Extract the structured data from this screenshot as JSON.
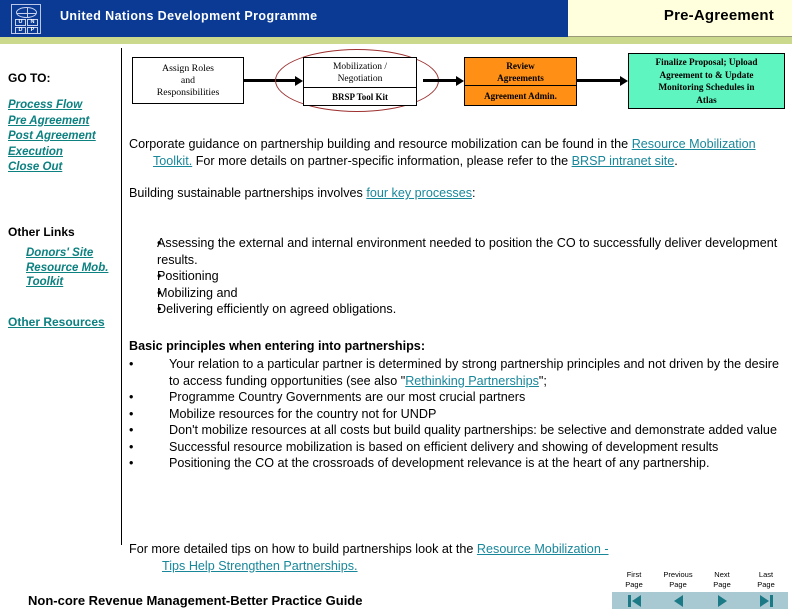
{
  "header": {
    "org_title": "United Nations Development Programme",
    "section_title": "Pre-Agreement",
    "logo_letters": [
      "U",
      "N",
      "D",
      "P"
    ],
    "blue": "#0a3a93",
    "stripe": "#cbd98c",
    "cream": "#ffffdd"
  },
  "sidebar": {
    "goto_label": "GO TO:",
    "goto_links": [
      {
        "label": "Process Flow"
      },
      {
        "label": "Pre Agreement"
      },
      {
        "label": "Post Agreement"
      },
      {
        "label": "Execution"
      },
      {
        "label": "Close Out"
      }
    ],
    "other_links_label": "Other Links",
    "other_links": [
      {
        "label": "Donors' Site"
      },
      {
        "label": "Resource Mob."
      },
      {
        "label": "  Toolkit"
      }
    ],
    "other_resources_label": "Other Resources",
    "link_color": "#0d8080"
  },
  "flow": {
    "assign": "Assign Roles and Responsibilities",
    "assign_lines": [
      "Assign Roles",
      "and",
      "Responsibilities"
    ],
    "mobilization": "Mobilization / Negotiation",
    "mobilization_lines": [
      "Mobilization /",
      "Negotiation"
    ],
    "toolkit": "BRSP Tool Kit",
    "review": "Review Agreements",
    "review_lines": [
      "Review",
      "Agreements"
    ],
    "agreement_admin": "Agreement Admin.",
    "finalize": "Finalize Proposal; Upload Agreement to & Update Monitoring Schedules in Atlas",
    "finalize_lines": [
      "Finalize Proposal; Upload",
      "Agreement to & Update",
      "Monitoring Schedules in",
      "Atlas"
    ],
    "oval_color": "#9d3030",
    "review_color": "#ff9015",
    "finalize_color": "#5ff5c0"
  },
  "main": {
    "intro_part1": "Corporate guidance on partnership building and resource mobilization can be found in the ",
    "intro_link1": "Resource Mobilization Toolkit.",
    "intro_part2": " For more details on partner-specific information, please refer to the ",
    "intro_link2": "BRSP intranet site",
    "intro_part3": ".",
    "processes_part1": "Building sustainable partnerships involves ",
    "processes_link": "four key processes",
    "processes_part2": ":",
    "process_bullets": [
      "Assessing the external and internal environment needed to position the CO to successfully   deliver development results.",
      "Positioning",
      "Mobilizing and",
      "Delivering efficiently on agreed obligations."
    ],
    "principles_title": "Basic  principles when entering into partnerships:",
    "principle_bullets": [
      {
        "text_before": "Your relation to a particular partner is determined by strong partnership principles and not driven by the desire to access funding opportunities (see also \"",
        "link": "Rethinking Partnerships",
        "text_after": "\";"
      },
      {
        "text_before": "Programme Country Governments are our most crucial partners",
        "link": "",
        "text_after": ""
      },
      {
        "text_before": "Mobilize resources for the country not for UNDP",
        "link": "",
        "text_after": ""
      },
      {
        "text_before": "Don't mobilize resources at all costs but build quality partnerships: be selective and demonstrate added value",
        "link": "",
        "text_after": ""
      },
      {
        "text_before": "Successful resource mobilization is based on efficient delivery and showing of development results",
        "link": "",
        "text_after": ""
      },
      {
        "text_before": "Positioning the CO at the crossroads of development relevance is at the heart of any partnership.",
        "link": "",
        "text_after": ""
      }
    ],
    "bullet_glyph": "•",
    "tips_part1": "For more detailed tips on how to build partnerships look at the ",
    "tips_link1": "Resource Mobilization -",
    "tips_link2": "Tips  Help  Strengthen  Partnerships.",
    "link_color": "#19879a"
  },
  "footer": {
    "title": "Non-core Revenue Management-Better Practice Guide"
  },
  "pagenav": {
    "buttons": [
      {
        "label_line1": "First",
        "label_line2": "Page",
        "icon": "first-page-icon"
      },
      {
        "label_line1": "Previous",
        "label_line2": "Page",
        "icon": "previous-page-icon"
      },
      {
        "label_line1": "Next",
        "label_line2": "Page",
        "icon": "next-page-icon"
      },
      {
        "label_line1": "Last",
        "label_line2": "Page",
        "icon": "last-page-icon"
      }
    ],
    "bar_color": "#a9c9d2",
    "arrow_color": "#1b7a86"
  }
}
